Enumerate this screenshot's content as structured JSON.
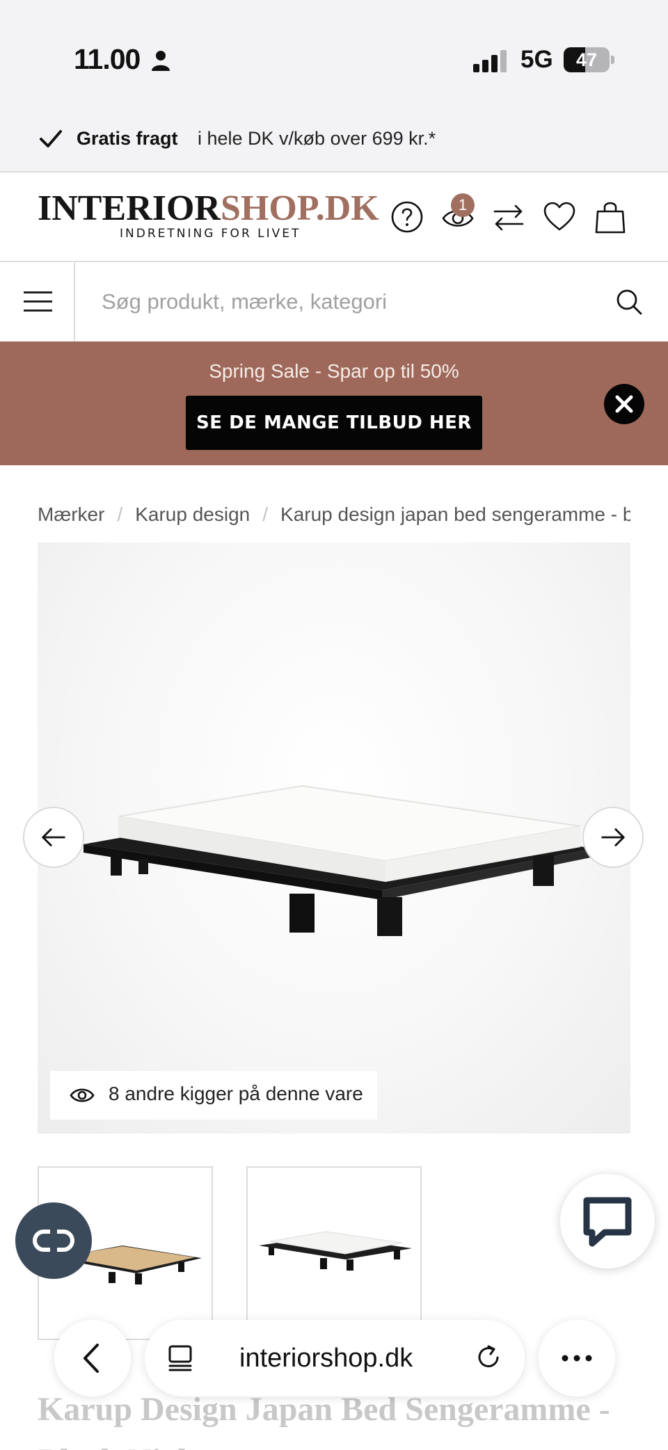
{
  "status_bar": {
    "time": "11.00",
    "network": "5G",
    "battery": "47",
    "battery_level": 0.47
  },
  "shipping": {
    "strong": "Gratis fragt",
    "text": "i hele DK v/køb over 699 kr.*"
  },
  "header": {
    "logo_main": "INTERIOR",
    "logo_accent": "SHOP.DK",
    "logo_tagline": "INDRETNING FOR LIVET",
    "recently_viewed_count": "1",
    "icons": [
      "help-icon",
      "recently-viewed-icon",
      "compare-icon",
      "heart-icon",
      "bag-icon"
    ]
  },
  "search": {
    "placeholder": "Søg produkt, mærke, kategori"
  },
  "promo": {
    "text": "Spring Sale - Spar op til 50%",
    "button": "SE DE MANGE TILBUD HER"
  },
  "breadcrumb": {
    "items": [
      "Mærker",
      "Karup design",
      "Karup design japan bed sengeramme - b"
    ]
  },
  "gallery": {
    "viewers_text": "8 andre kigger på denne vare"
  },
  "product": {
    "title": "Karup Design Japan Bed Sengeramme - Black Night"
  },
  "browser": {
    "url": "interiorshop.dk"
  },
  "colors": {
    "brand_accent": "#a06f60",
    "promo_bg": "#9e695a",
    "co_button": "#3b4a5b"
  }
}
